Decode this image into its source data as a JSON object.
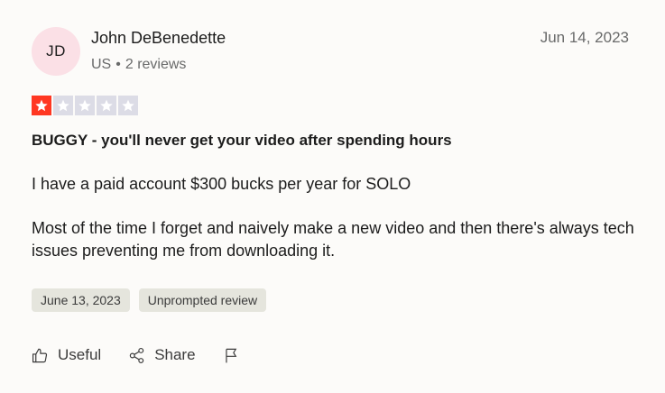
{
  "reviewer": {
    "initials": "JD",
    "name": "John DeBenedette",
    "country": "US",
    "separator": "•",
    "reviews_count": "2 reviews"
  },
  "review": {
    "date": "Jun 14, 2023",
    "rating": 1,
    "max_rating": 5,
    "title": "BUGGY - you'll never get your video after spending hours",
    "paragraphs": [
      "I have a paid account $300 bucks per year for SOLO",
      "Most of the time I forget and naively make a new video and then there's always tech issues preventing me from downloading it."
    ],
    "tags": [
      "June 13, 2023",
      "Unprompted review"
    ]
  },
  "actions": {
    "useful_label": "Useful",
    "share_label": "Share"
  },
  "colors": {
    "star_filled": "#ff3722",
    "star_empty": "#dcdce6",
    "avatar_bg": "#fbe0e6"
  },
  "icons": [
    "star-icon",
    "thumbs-up-icon",
    "share-icon",
    "flag-icon"
  ]
}
